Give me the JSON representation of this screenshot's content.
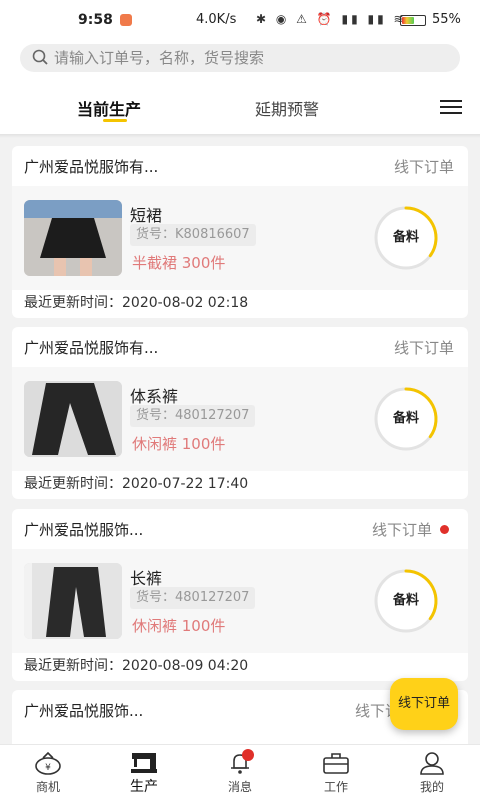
{
  "status_bar": {
    "time": "9:58",
    "network": "4.0K/s",
    "sys_icons": "✱ ◉ ⚠ ⏰ ▮▮ ▮▮ ≋",
    "battery_percent": "55",
    "battery_text": "55%"
  },
  "search": {
    "placeholder": "请输入订单号，名称，货号搜索"
  },
  "tabs": [
    {
      "label": "当前生产",
      "active": true
    },
    {
      "label": "延期预警",
      "active": false
    }
  ],
  "orders": [
    {
      "company": "广州爱品悦服饰有...",
      "order_type": "线下订单",
      "unread": false,
      "product_name": "短裙",
      "sku": "货号：K80816607",
      "quantity_text": "半截裙 300件",
      "status": "备料",
      "status_progress": 0.35,
      "updated": "最近更新时间：2020-08-02 02:18"
    },
    {
      "company": "广州爱品悦服饰有...",
      "order_type": "线下订单",
      "unread": false,
      "product_name": "体系裤",
      "sku": "货号：480127207",
      "quantity_text": "休闲裤 100件",
      "status": "备料",
      "status_progress": 0.35,
      "updated": "最近更新时间：2020-07-22 17:40"
    },
    {
      "company": "广州爱品悦服饰...",
      "order_type": "线下订单",
      "unread": true,
      "product_name": "长裤",
      "sku": "货号：480127207",
      "quantity_text": "休闲裤 100件",
      "status": "备料",
      "status_progress": 0.35,
      "updated": "最近更新时间：2020-08-09 04:20"
    },
    {
      "company": "广州爱品悦服饰...",
      "order_type": "线下订",
      "unread": false
    }
  ],
  "fab_label": "线下订单",
  "bottom_nav": [
    {
      "label": "商机",
      "icon": "money-bag-icon",
      "active": false
    },
    {
      "label": "生产",
      "icon": "sewing-machine-icon",
      "active": true
    },
    {
      "label": "消息",
      "icon": "bell-icon",
      "active": false,
      "badge": true
    },
    {
      "label": "工作",
      "icon": "briefcase-icon",
      "active": false
    },
    {
      "label": "我的",
      "icon": "user-icon",
      "active": false
    }
  ],
  "colors": {
    "accent": "#f4c400",
    "fab": "#ffd118",
    "quantity": "#e07a7a",
    "badge": "#e0302a"
  }
}
